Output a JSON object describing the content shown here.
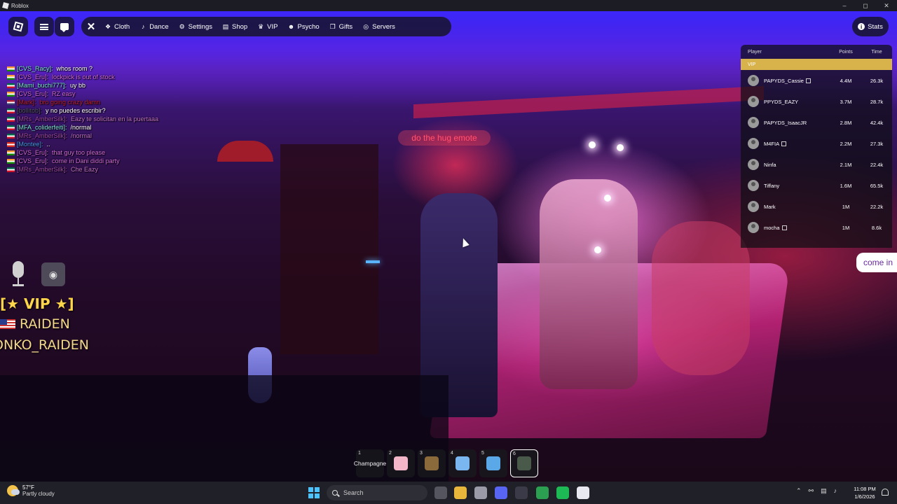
{
  "window": {
    "title": "Roblox"
  },
  "topbar": {
    "menu_items": [
      {
        "label": "Cloth",
        "icon": "shirt-icon",
        "glyph": "❖"
      },
      {
        "label": "Dance",
        "icon": "music-note-icon",
        "glyph": "♪"
      },
      {
        "label": "Settings",
        "icon": "gear-icon",
        "glyph": "⚙"
      },
      {
        "label": "Shop",
        "icon": "cart-icon",
        "glyph": "▤"
      },
      {
        "label": "VIP",
        "icon": "crown-icon",
        "glyph": "♛"
      },
      {
        "label": "Psycho",
        "icon": "skull-icon",
        "glyph": "☻"
      },
      {
        "label": "Gifts",
        "icon": "gift-icon",
        "glyph": "❐"
      },
      {
        "label": "Servers",
        "icon": "globe-icon",
        "glyph": "◎"
      }
    ],
    "stats_label": "Stats"
  },
  "chat": [
    {
      "name": "[CVS_Racy]:",
      "message": "whos room ?",
      "name_color": "#7ee8d8",
      "msg_color": "#ffffff",
      "flag": [
        "#ff9933",
        "#ffffff",
        "#138808"
      ]
    },
    {
      "name": "[CVS_Eru]:",
      "message": "lockpick is out of stock",
      "name_color": "#d06ad8",
      "msg_color": "#d06ad8",
      "flag": [
        "#ff9933",
        "#ffffff",
        "#138808"
      ]
    },
    {
      "name": "[Mami_buchi777]:",
      "message": "uy bb",
      "name_color": "#7ee8d8",
      "msg_color": "#ffffff",
      "flag": [
        "#006847",
        "#ffffff",
        "#ce1126"
      ]
    },
    {
      "name": "[CVS_Eru]:",
      "message": "RZ easy",
      "name_color": "#d06ad8",
      "msg_color": "#d06ad8",
      "flag": [
        "#ff9933",
        "#ffffff",
        "#138808"
      ]
    },
    {
      "name": "[Mark]:",
      "message": "bro going crazy damn",
      "name_color": "#c02030",
      "msg_color": "#c02030",
      "flag": [
        "#b22234",
        "#ffffff",
        "#3c3b6e"
      ]
    },
    {
      "name": "[bollitob]:",
      "message": "y no puedes escribir?",
      "name_color": "#555566",
      "msg_color": "#ffffff",
      "flag": [
        "#006847",
        "#ffffff",
        "#ce1126"
      ]
    },
    {
      "name": "[MRs_AmberSilk]:",
      "message": "Eazy te solicitan en la puertaaa",
      "name_color": "#a048a8",
      "msg_color": "#c070c8",
      "flag": [
        "#006847",
        "#ffffff",
        "#ce1126"
      ]
    },
    {
      "name": "[MFA_coliderfeiti]:",
      "message": "/normal",
      "name_color": "#7ee8d8",
      "msg_color": "#ffffff",
      "flag": [
        "#006847",
        "#ffffff",
        "#ce1126"
      ]
    },
    {
      "name": "[MRs_AmberSilk]:",
      "message": "/normal",
      "name_color": "#a048a8",
      "msg_color": "#c070c8",
      "flag": [
        "#006847",
        "#ffffff",
        "#ce1126"
      ]
    },
    {
      "name": "[Montee]:",
      "message": "..",
      "name_color": "#4a9af0",
      "msg_color": "#ffffff",
      "flag": [
        "#d52b1e",
        "#ffffff",
        "#d52b1e"
      ]
    },
    {
      "name": "[CVS_Eru]:",
      "message": "that guy too please",
      "name_color": "#d06ad8",
      "msg_color": "#d06ad8",
      "flag": [
        "#ff9933",
        "#ffffff",
        "#138808"
      ]
    },
    {
      "name": "[CVS_Eru]:",
      "message": "come in Dani diddi party",
      "name_color": "#d06ad8",
      "msg_color": "#d06ad8",
      "flag": [
        "#ff9933",
        "#ffffff",
        "#138808"
      ]
    },
    {
      "name": "[MRs_AmberSilk]:",
      "message": "Che Eazy",
      "name_color": "#a048a8",
      "msg_color": "#c070c8",
      "flag": [
        "#006847",
        "#ffffff",
        "#ce1126"
      ]
    }
  ],
  "nametags": {
    "vip": "[★ VIP ★]",
    "display_name": "RAIDEN",
    "username": "ONKO_RAIDEN"
  },
  "bubbles": {
    "emote": "do the hug emote",
    "edge": "come in"
  },
  "leaderboard": {
    "headers": {
      "player": "Player",
      "points": "Points",
      "time": "Time"
    },
    "group": "VIP",
    "rows": [
      {
        "name": "PAPYDS_Cassie",
        "points": "4.4M",
        "time": "26.3k",
        "badge": true
      },
      {
        "name": "PPYDS_EAZY",
        "points": "3.7M",
        "time": "28.7k",
        "badge": false
      },
      {
        "name": "PAPYDS_IsaacJR",
        "points": "2.8M",
        "time": "42.4k",
        "badge": false
      },
      {
        "name": "M4FIA",
        "points": "2.2M",
        "time": "27.3k",
        "badge": true
      },
      {
        "name": "Ninfa",
        "points": "2.1M",
        "time": "22.4k",
        "badge": false
      },
      {
        "name": "Tiffany",
        "points": "1.6M",
        "time": "65.5k",
        "badge": false
      },
      {
        "name": "Mark",
        "points": "1M",
        "time": "22.2k",
        "badge": false
      },
      {
        "name": "mocha",
        "points": "1M",
        "time": "8.6k",
        "badge": true
      }
    ]
  },
  "hotbar": [
    {
      "num": "1",
      "label": "Champagne",
      "color": ""
    },
    {
      "num": "2",
      "label": "",
      "color": "#f3b6c8"
    },
    {
      "num": "3",
      "label": "",
      "color": "#8a6a3a"
    },
    {
      "num": "4",
      "label": "",
      "color": "#7ab6f0"
    },
    {
      "num": "5",
      "label": "",
      "color": "#5aa8e8"
    },
    {
      "num": "6",
      "label": "",
      "color": "#4a5a4a"
    }
  ],
  "taskbar": {
    "weather_temp": "57°F",
    "weather_cond": "Partly cloudy",
    "search_placeholder": "Search",
    "time": "11:08 PM",
    "date": "1/6/2026",
    "apps": [
      {
        "name": "task-view-icon",
        "color": "#555560"
      },
      {
        "name": "file-explorer-icon",
        "color": "#e8b63a"
      },
      {
        "name": "roblox-studio-icon",
        "color": "#9a9aa8"
      },
      {
        "name": "discord-icon",
        "color": "#5865f2"
      },
      {
        "name": "arrow-app-icon",
        "color": "#3a3a48"
      },
      {
        "name": "chrome-icon",
        "color": "#2aa050"
      },
      {
        "name": "spotify-icon",
        "color": "#1db954"
      },
      {
        "name": "roblox-icon",
        "color": "#e8e8f0"
      }
    ]
  }
}
